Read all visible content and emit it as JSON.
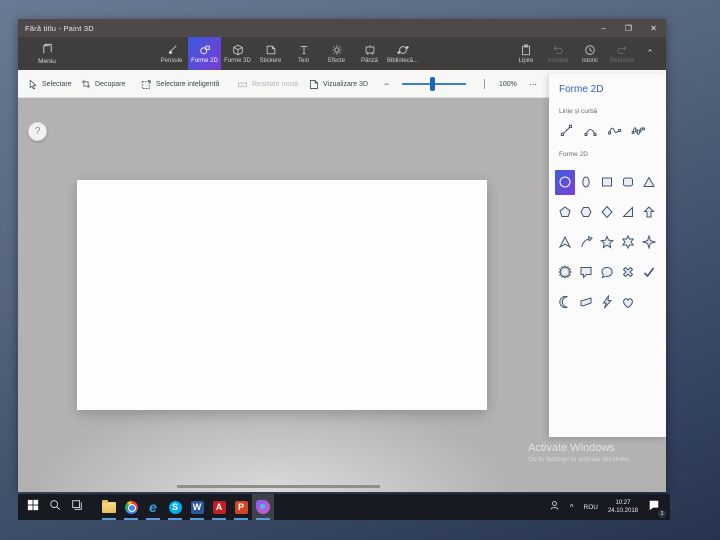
{
  "window": {
    "title": "Fără titlu - Paint 3D",
    "controls": {
      "minimize": "–",
      "restore": "❐",
      "close": "✕"
    }
  },
  "toolbar": {
    "menu_label": "Meniu",
    "tabs": [
      {
        "label": "Pensule",
        "icon": "brush-icon",
        "selected": false
      },
      {
        "label": "Forme 2D",
        "icon": "shapes-2d-icon",
        "selected": true
      },
      {
        "label": "Forme 3D",
        "icon": "shapes-3d-icon",
        "selected": false
      },
      {
        "label": "Stickere",
        "icon": "sticker-icon",
        "selected": false
      },
      {
        "label": "Text",
        "icon": "text-icon",
        "selected": false
      },
      {
        "label": "Efecte",
        "icon": "effects-icon",
        "selected": false
      },
      {
        "label": "Pânză",
        "icon": "canvas-icon",
        "selected": false
      },
      {
        "label": "Bibliotecă...",
        "icon": "library-icon",
        "selected": false
      }
    ],
    "selected_tab": "Forme 2D",
    "actions": [
      {
        "label": "Lipire",
        "icon": "paste-icon",
        "enabled": true
      },
      {
        "label": "Anulare",
        "icon": "undo-icon",
        "enabled": false
      },
      {
        "label": "Istoric",
        "icon": "history-icon",
        "enabled": true
      },
      {
        "label": "Refacere",
        "icon": "redo-icon",
        "enabled": false
      }
    ],
    "collapse_glyph": "⌃"
  },
  "subtoolbar": {
    "items": [
      {
        "label": "Selectare",
        "icon": "select-cursor-icon",
        "enabled": true
      },
      {
        "label": "Decupare",
        "icon": "crop-icon",
        "enabled": true
      },
      {
        "label": "Selectare inteligentă",
        "icon": "magic-select-icon",
        "enabled": true
      },
      {
        "label": "Realitate mixtă",
        "icon": "mixed-reality-icon",
        "enabled": false
      },
      {
        "label": "Vizualizare 3D",
        "icon": "3d-view-icon",
        "enabled": true
      }
    ],
    "zoom": {
      "minus": "−",
      "value": "100%",
      "more": "⋯"
    }
  },
  "panel": {
    "title": "Forme 2D",
    "line_section_label": "Linie și curbă",
    "line_tools": [
      "line",
      "curve",
      "wave",
      "double-curve"
    ],
    "shapes_section_label": "Forme 2D",
    "selected_shape": "circle",
    "shapes": [
      "circle",
      "oval",
      "square",
      "rounded-square",
      "triangle",
      "pentagon",
      "hexagon",
      "diamond",
      "right-triangle",
      "arrow-up",
      "arrowhead",
      "curved-arrow",
      "star-5",
      "star-6",
      "star-4",
      "starburst",
      "speech-bubble-square",
      "speech-bubble-round",
      "cross",
      "checkmark",
      "crescent",
      "banner",
      "lightning",
      "heart"
    ]
  },
  "workspace": {
    "help_label": "?"
  },
  "watermark": {
    "line1": "Activate Windows",
    "line2": "Go to Settings to activate Windows."
  },
  "taskbar": {
    "apps": [
      "start",
      "search",
      "task-view",
      "file-explorer",
      "chrome",
      "edge",
      "skype",
      "word",
      "acrobat",
      "powerpoint",
      "paint-3d"
    ],
    "glyphs": {
      "edge": "e",
      "skype": "S",
      "word": "W",
      "acrobat": "A",
      "powerpoint": "P"
    },
    "active_app": "paint-3d",
    "tray": {
      "chevron": "^",
      "language": "ROU",
      "time": "10:27",
      "date": "24.10.2018",
      "notification_badge": "1"
    }
  },
  "colors": {
    "accent_blue": "#2a63c0",
    "selected_tab_gradient": [
      "#3a5bd9",
      "#7a3cd6"
    ],
    "titlebar": "#4e4948",
    "toolbar": "#3f3e3d",
    "workspace": "#b3b2b0",
    "taskbar": "#171a21",
    "slide_background": [
      "#6b7a94",
      "#263450"
    ]
  }
}
